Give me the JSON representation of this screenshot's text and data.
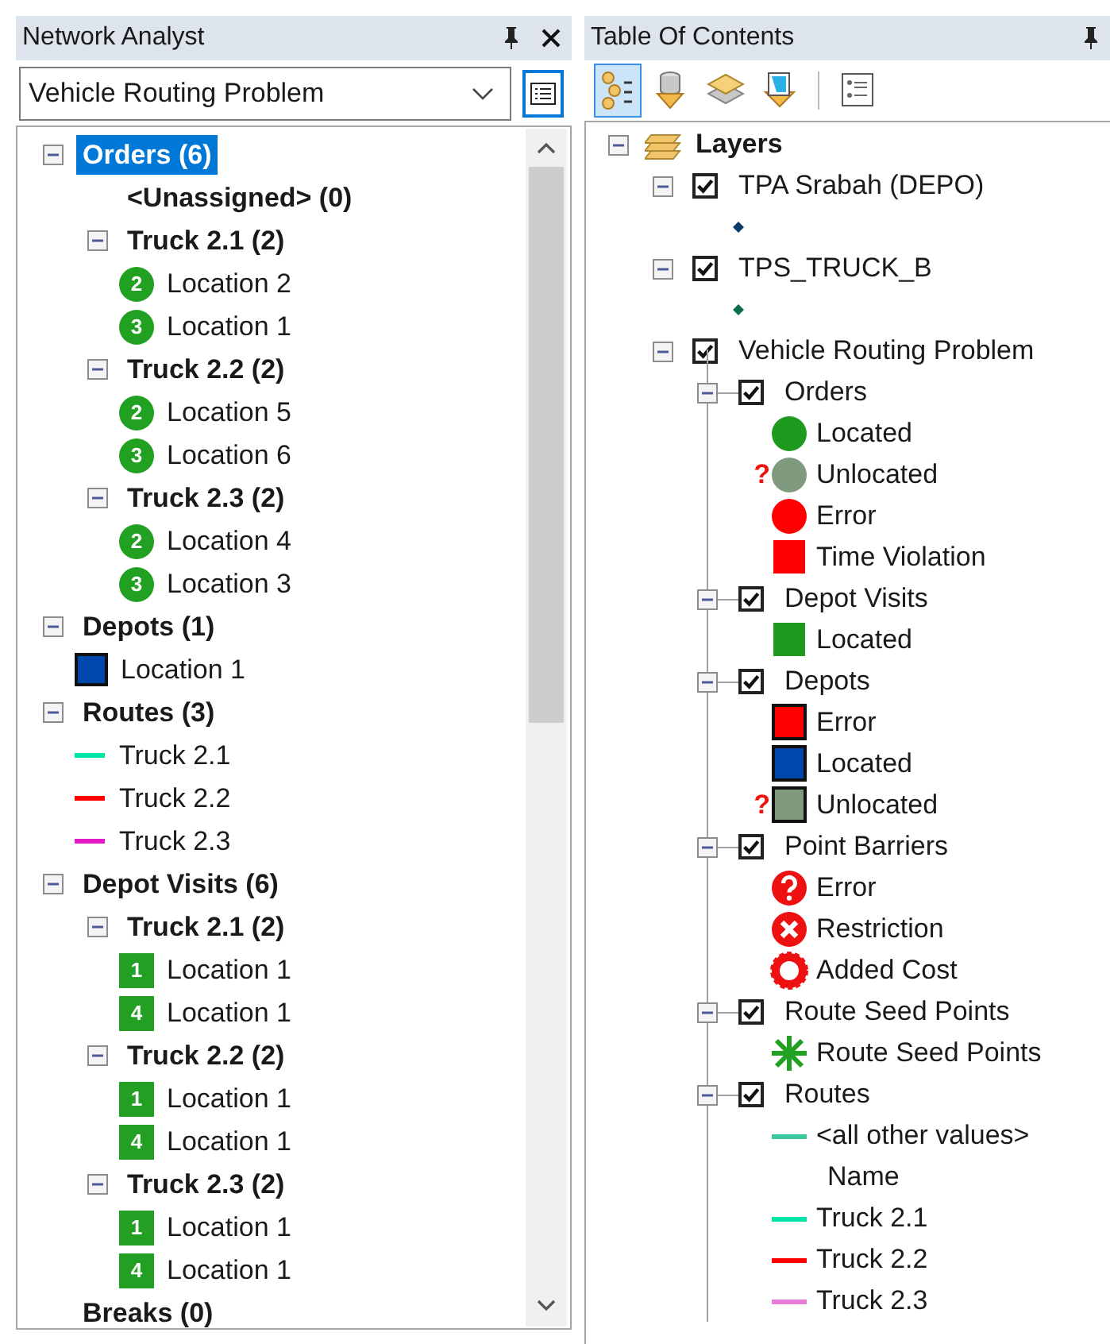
{
  "network_analyst": {
    "title": "Network Analyst",
    "solver": {
      "value": "Vehicle Routing Problem"
    },
    "tree": [
      {
        "kind": "group",
        "label": "Orders (6)",
        "expanded": true,
        "selected": true,
        "children": [
          {
            "kind": "empty",
            "label": "<Unassigned> (0)",
            "selected": false
          },
          {
            "kind": "group",
            "label": "Truck 2.1 (2)",
            "expanded": true,
            "selected": false,
            "children": [
              {
                "kind": "order",
                "badge": "2",
                "label": "Location 2",
                "selected": false
              },
              {
                "kind": "order",
                "badge": "3",
                "label": "Location 1",
                "selected": false
              }
            ]
          },
          {
            "kind": "group",
            "label": "Truck 2.2 (2)",
            "expanded": true,
            "selected": false,
            "children": [
              {
                "kind": "order",
                "badge": "2",
                "label": "Location 5",
                "selected": false
              },
              {
                "kind": "order",
                "badge": "3",
                "label": "Location 6",
                "selected": false
              }
            ]
          },
          {
            "kind": "group",
            "label": "Truck 2.3 (2)",
            "expanded": true,
            "selected": false,
            "children": [
              {
                "kind": "order",
                "badge": "2",
                "label": "Location 4",
                "selected": false
              },
              {
                "kind": "order",
                "badge": "3",
                "label": "Location 3",
                "selected": false
              }
            ]
          }
        ]
      },
      {
        "kind": "group",
        "label": "Depots (1)",
        "expanded": true,
        "selected": false,
        "children": [
          {
            "kind": "depot",
            "color": "#0047ab",
            "label": "Location 1",
            "selected": false
          }
        ]
      },
      {
        "kind": "group",
        "label": "Routes (3)",
        "expanded": true,
        "selected": false,
        "children": [
          {
            "kind": "route",
            "color": "#00e6a8",
            "label": "Truck 2.1",
            "selected": false
          },
          {
            "kind": "route",
            "color": "#ff0000",
            "label": "Truck 2.2",
            "selected": false
          },
          {
            "kind": "route",
            "color": "#e619c8",
            "label": "Truck 2.3",
            "selected": false
          }
        ]
      },
      {
        "kind": "group",
        "label": "Depot Visits (6)",
        "expanded": true,
        "selected": false,
        "children": [
          {
            "kind": "group",
            "label": "Truck 2.1 (2)",
            "expanded": true,
            "selected": false,
            "children": [
              {
                "kind": "visit",
                "badge": "1",
                "label": "Location 1",
                "selected": false
              },
              {
                "kind": "visit",
                "badge": "4",
                "label": "Location 1",
                "selected": false
              }
            ]
          },
          {
            "kind": "group",
            "label": "Truck 2.2 (2)",
            "expanded": true,
            "selected": false,
            "children": [
              {
                "kind": "visit",
                "badge": "1",
                "label": "Location 1",
                "selected": false
              },
              {
                "kind": "visit",
                "badge": "4",
                "label": "Location 1",
                "selected": false
              }
            ]
          },
          {
            "kind": "group",
            "label": "Truck 2.3 (2)",
            "expanded": true,
            "selected": false,
            "children": [
              {
                "kind": "visit",
                "badge": "1",
                "label": "Location 1",
                "selected": false
              },
              {
                "kind": "visit",
                "badge": "4",
                "label": "Location 1",
                "selected": false
              }
            ]
          }
        ]
      },
      {
        "kind": "empty",
        "label": "Breaks (0)",
        "selected": false
      }
    ]
  },
  "table_of_contents": {
    "title": "Table Of Contents",
    "toolbar": [
      {
        "kind": "drawing_order",
        "selected": true
      },
      {
        "kind": "source",
        "selected": false
      },
      {
        "kind": "visibility",
        "selected": false
      },
      {
        "kind": "selection",
        "selected": false
      },
      {
        "kind": "options",
        "selected": false
      }
    ],
    "tree": {
      "label": "Layers",
      "expanded": true,
      "children": [
        {
          "label": "TPA Srabah (DEPO)",
          "checked": true,
          "expanded": true,
          "legend": [
            {
              "kind": "diamond",
              "color": "#0b3a6e"
            }
          ]
        },
        {
          "label": "TPS_TRUCK_B",
          "checked": true,
          "expanded": true,
          "legend": [
            {
              "kind": "diamond",
              "color": "#0f6e4a"
            }
          ]
        },
        {
          "label": "Vehicle Routing Problem",
          "checked": true,
          "expanded": true,
          "children": [
            {
              "label": "Orders",
              "checked": true,
              "expanded": true,
              "legend": [
                {
                  "kind": "circle",
                  "color": "#1e9a1e",
                  "label": "Located"
                },
                {
                  "kind": "circle",
                  "color": "#7f9a7f",
                  "mark": "?",
                  "label": "Unlocated"
                },
                {
                  "kind": "circle",
                  "color": "#ff0000",
                  "label": "Error"
                },
                {
                  "kind": "square",
                  "color": "#ff0000",
                  "outlined": false,
                  "label": "Time Violation"
                }
              ]
            },
            {
              "label": "Depot Visits",
              "checked": true,
              "expanded": true,
              "legend": [
                {
                  "kind": "square",
                  "color": "#1e9a1e",
                  "outlined": false,
                  "label": "Located"
                }
              ]
            },
            {
              "label": "Depots",
              "checked": true,
              "expanded": true,
              "legend": [
                {
                  "kind": "square",
                  "color": "#ff0000",
                  "outlined": true,
                  "label": "Error"
                },
                {
                  "kind": "square",
                  "color": "#0047ab",
                  "outlined": true,
                  "label": "Located"
                },
                {
                  "kind": "square",
                  "color": "#7f9a7f",
                  "outlined": true,
                  "mark": "?",
                  "label": "Unlocated"
                }
              ]
            },
            {
              "label": "Point Barriers",
              "checked": true,
              "expanded": true,
              "legend": [
                {
                  "kind": "question_badge",
                  "label": "Error"
                },
                {
                  "kind": "cross_badge",
                  "label": "Restriction"
                },
                {
                  "kind": "ring",
                  "label": "Added Cost"
                }
              ]
            },
            {
              "label": "Route Seed Points",
              "checked": true,
              "expanded": true,
              "legend": [
                {
                  "kind": "asterisk",
                  "label": "Route Seed Points"
                }
              ]
            },
            {
              "label": "Routes",
              "checked": true,
              "expanded": true,
              "legend": [
                {
                  "kind": "line",
                  "color": "#3cc8a0",
                  "label": "<all other values>"
                },
                {
                  "kind": "heading",
                  "label": "Name"
                },
                {
                  "kind": "line",
                  "color": "#00e6a8",
                  "label": "Truck 2.1"
                },
                {
                  "kind": "line",
                  "color": "#ff0000",
                  "label": "Truck 2.2"
                },
                {
                  "kind": "line",
                  "color": "#e87ad8",
                  "label": "Truck 2.3"
                }
              ]
            }
          ]
        }
      ]
    }
  }
}
